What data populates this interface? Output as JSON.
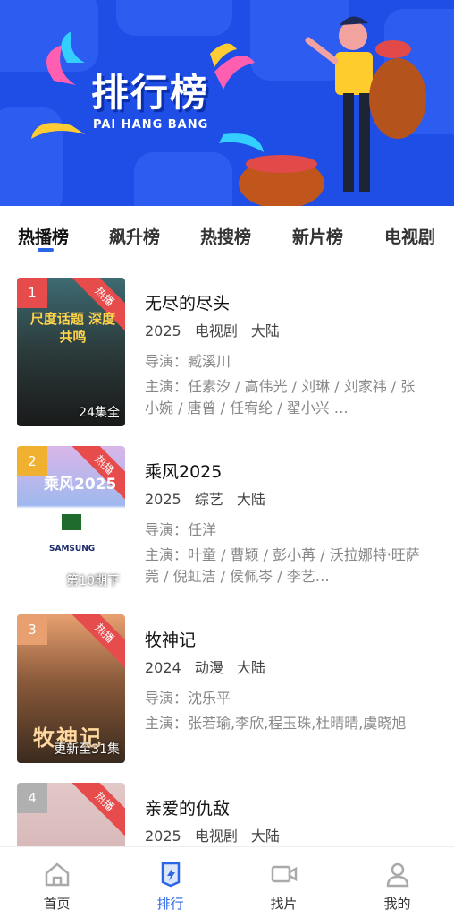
{
  "banner": {
    "title": "排行榜",
    "subtitle": "PAI HANG BANG"
  },
  "tabs": [
    {
      "label": "热播榜",
      "active": true
    },
    {
      "label": "飙升榜",
      "active": false
    },
    {
      "label": "热搜榜",
      "active": false
    },
    {
      "label": "新片榜",
      "active": false
    },
    {
      "label": "电视剧",
      "active": false
    }
  ],
  "items": [
    {
      "rank": "1",
      "badge": "热播",
      "caption": "24集全",
      "poster_text": "尺度话题 深度共鸣",
      "title": "无尽的尽头",
      "year": "2025",
      "genre": "电视剧",
      "region": "大陆",
      "director": "导演：臧溪川",
      "cast": "主演：任素汐 / 高伟光 / 刘琳 / 刘家祎 / 张小婉 / 唐曾 / 任宥纶 / 翟小兴 …",
      "rank_color": "#e74c4c"
    },
    {
      "rank": "2",
      "badge": "热播",
      "caption": "第10期下",
      "poster_text": "乘风2025",
      "title": "乘风2025",
      "year": "2025",
      "genre": "综艺",
      "region": "大陆",
      "director": "导演：任洋",
      "cast": "主演：叶童 / 曹颖 / 彭小苒 / 沃拉娜特·旺萨莞 / 倪虹洁 / 侯佩岑 / 李艺…",
      "rank_color": "#f0b030"
    },
    {
      "rank": "3",
      "badge": "热播",
      "caption": "更新至31集",
      "poster_text": "牧神记",
      "title": "牧神记",
      "year": "2024",
      "genre": "动漫",
      "region": "大陆",
      "director": "导演：沈乐平",
      "cast": "主演：张若瑜,李欣,程玉珠,杜晴晴,虞晓旭",
      "rank_color": "#e8a070"
    },
    {
      "rank": "4",
      "badge": "热播",
      "caption": "",
      "poster_text": "",
      "title": "亲爱的仇敌",
      "year": "2025",
      "genre": "电视剧",
      "region": "大陆",
      "director": "",
      "cast": "",
      "rank_color": "#b0b0b0"
    }
  ],
  "bottom_nav": [
    {
      "label": "首页",
      "icon": "home-icon",
      "active": false
    },
    {
      "label": "排行",
      "icon": "ranking-icon",
      "active": true
    },
    {
      "label": "找片",
      "icon": "video-icon",
      "active": false
    },
    {
      "label": "我的",
      "icon": "user-icon",
      "active": false
    }
  ],
  "colors": {
    "accent": "#2a65e8",
    "banner": "#1f4ee6",
    "badge": "#e74c4c"
  }
}
